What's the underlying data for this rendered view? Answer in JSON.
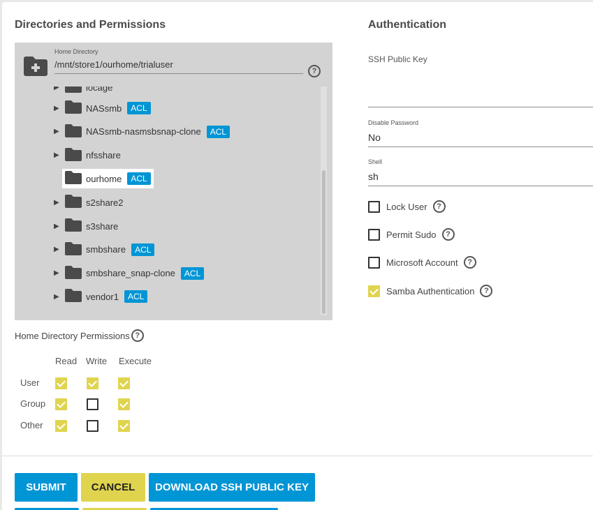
{
  "left_section": {
    "title": "Directories and Permissions"
  },
  "right_section": {
    "title": "Authentication"
  },
  "home_directory": {
    "label": "Home Directory",
    "value": "/mnt/store1/ourhome/trialuser"
  },
  "tree": {
    "partial_item": "iocage",
    "items": [
      {
        "name": "NASsmb",
        "acl": "ACL",
        "expandable": true
      },
      {
        "name": "NASsmb-nasmsbsnap-clone",
        "acl": "ACL",
        "expandable": true
      },
      {
        "name": "nfsshare",
        "acl": "",
        "expandable": true
      },
      {
        "name": "ourhome",
        "acl": "ACL",
        "expandable": false,
        "selected": true
      },
      {
        "name": "s2share2",
        "acl": "",
        "expandable": true
      },
      {
        "name": "s3share",
        "acl": "",
        "expandable": true
      },
      {
        "name": "smbshare",
        "acl": "ACL",
        "expandable": true
      },
      {
        "name": "smbshare_snap-clone",
        "acl": "ACL",
        "expandable": true
      },
      {
        "name": "vendor1",
        "acl": "ACL",
        "expandable": true
      }
    ]
  },
  "permissions": {
    "title": "Home Directory Permissions",
    "columns": [
      "Read",
      "Write",
      "Execute"
    ],
    "rows": [
      {
        "label": "User",
        "values": [
          true,
          true,
          true
        ]
      },
      {
        "label": "Group",
        "values": [
          true,
          false,
          true
        ]
      },
      {
        "label": "Other",
        "values": [
          true,
          false,
          true
        ]
      }
    ]
  },
  "auth": {
    "ssh_label": "SSH Public Key",
    "disable_password_label": "Disable Password",
    "disable_password_value": "No",
    "shell_label": "Shell",
    "shell_value": "sh",
    "checkboxes": [
      {
        "label": "Lock User",
        "checked": false
      },
      {
        "label": "Permit Sudo",
        "checked": false
      },
      {
        "label": "Microsoft Account",
        "checked": false
      },
      {
        "label": "Samba Authentication",
        "checked": true
      }
    ]
  },
  "buttons": {
    "submit": "SUBMIT",
    "cancel": "CANCEL",
    "download": "DOWNLOAD SSH PUBLIC KEY"
  },
  "colors": {
    "accent_blue": "#0095d5",
    "accent_yellow": "#e0d44e",
    "explorer_bg": "#d3d3d3"
  },
  "icons": {
    "folder": "folder-icon",
    "help": "help-icon",
    "expand": "triangle-right-icon"
  }
}
